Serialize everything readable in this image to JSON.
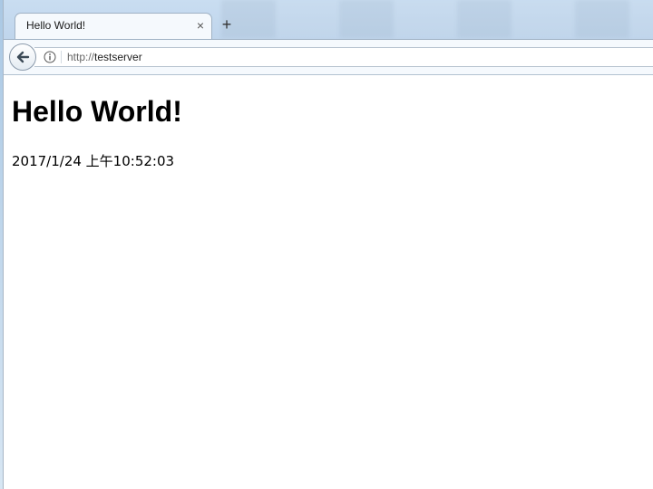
{
  "browser": {
    "tab": {
      "title": "Hello World!",
      "close_glyph": "×"
    },
    "new_tab_glyph": "+",
    "address_bar": {
      "scheme": "http://",
      "host": "testserver"
    },
    "icons": {
      "back": "back-arrow-icon",
      "site_info": "info-icon",
      "close_tab": "close-icon",
      "new_tab": "plus-icon"
    }
  },
  "page": {
    "heading": "Hello World!",
    "timestamp": "2017/1/24 上午10:52:03"
  }
}
